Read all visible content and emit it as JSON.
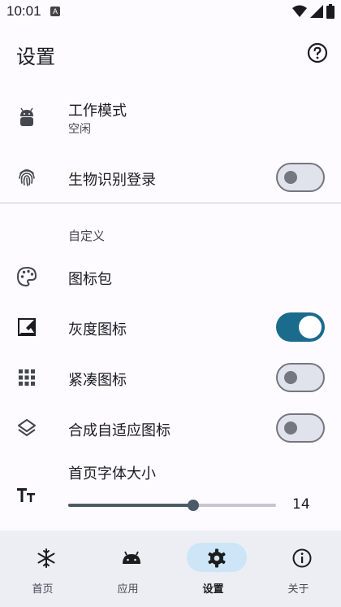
{
  "status": {
    "time": "10:01",
    "notification_glyph": "A"
  },
  "app_bar": {
    "title": "设置",
    "help_icon": "help-circle-icon"
  },
  "work_mode": {
    "label": "工作模式",
    "value": "空闲",
    "icon": "android-icon"
  },
  "biometric": {
    "label": "生物识别登录",
    "icon": "fingerprint-icon",
    "enabled": false
  },
  "customize": {
    "section_title": "自定义",
    "icon_pack": {
      "label": "图标包",
      "icon": "palette-icon"
    },
    "gray_icons": {
      "label": "灰度图标",
      "icon": "grayscale-image-icon",
      "enabled": true
    },
    "compact_icons": {
      "label": "紧凑图标",
      "icon": "grid-icon",
      "enabled": false
    },
    "adaptive_icons": {
      "label": "合成自适应图标",
      "icon": "layers-icon",
      "enabled": false
    },
    "home_font_size": {
      "label": "首页字体大小",
      "icon": "text-size-icon",
      "value": "14",
      "fraction": 0.6
    }
  },
  "nav": {
    "items": [
      {
        "label": "首页",
        "icon": "snowflake-icon",
        "active": false
      },
      {
        "label": "应用",
        "icon": "android-icon",
        "active": false
      },
      {
        "label": "设置",
        "icon": "gear-icon",
        "active": true
      },
      {
        "label": "关于",
        "icon": "info-icon",
        "active": false
      }
    ]
  },
  "colors": {
    "accent": "#1b6b8c",
    "nav_pill": "#cde5f6",
    "background": "#fdfbff",
    "nav_background": "#eceef4"
  }
}
